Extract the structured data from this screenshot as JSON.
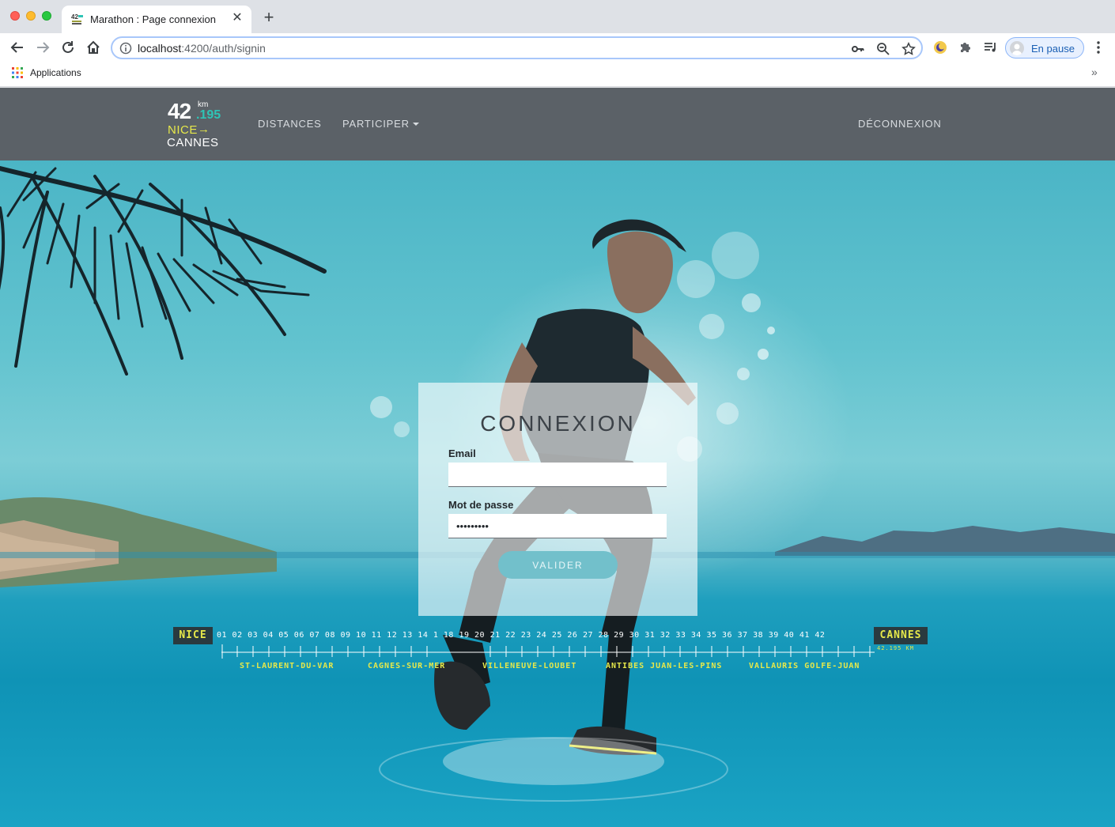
{
  "browser": {
    "tab_title": "Marathon : Page connexion",
    "url_host": "localhost",
    "url_path": ":4200/auth/signin",
    "profile_label": "En pause",
    "bookmarks": {
      "apps_label": "Applications"
    }
  },
  "site": {
    "brand": {
      "num": "42",
      "km": "km",
      "decimal": ".195",
      "from": "NICE",
      "arrow": "→",
      "to": "CANNES"
    },
    "nav": {
      "distances": "DISTANCES",
      "participer": "PARTICIPER",
      "logout": "DÉCONNEXION"
    }
  },
  "login": {
    "title": "CONNEXION",
    "email_label": "Email",
    "email_value": "",
    "password_label": "Mot de passe",
    "password_value": "•••••••••",
    "submit_label": "VALIDER"
  },
  "poster": {
    "start": "NICE",
    "end": "CANNES",
    "total": "42.195 KM",
    "km_marks": "01 02 03 04 05 06 07 08 09 10 11 12 13 14 1    18 19 20 21 22 23 24 25 26 27 28 29 30 31 32 33 34 35 36 37 38 39 40 41 42",
    "towns": [
      "ST-LAURENT-DU-VAR",
      "CAGNES-SUR-MER",
      "VILLENEUVE-LOUBET",
      "ANTIBES JUAN-LES-PINS",
      "VALLAURIS GOLFE-JUAN"
    ]
  },
  "colors": {
    "navbar": "#5b6167",
    "accent_yellow": "#e6e84a",
    "accent_teal": "#2ec4b6",
    "button": "#72c0cb"
  }
}
